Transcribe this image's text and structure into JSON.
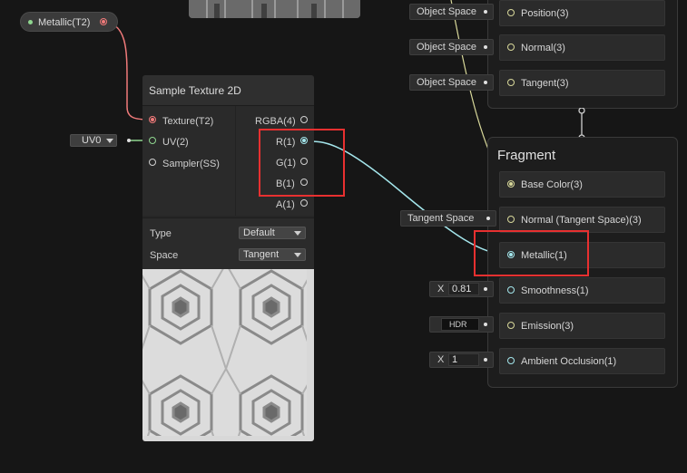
{
  "property_node": {
    "label": "Metallic(T2)"
  },
  "sample_texture": {
    "title": "Sample Texture 2D",
    "inputs": [
      "Texture(T2)",
      "UV(2)",
      "Sampler(SS)"
    ],
    "outputs": [
      "RGBA(4)",
      "R(1)",
      "G(1)",
      "B(1)",
      "A(1)"
    ],
    "type_label": "Type",
    "type_value": "Default",
    "space_label": "Space",
    "space_value": "Tangent"
  },
  "uv_field": {
    "value": "UV0"
  },
  "vertex_stack": {
    "blocks": [
      {
        "label": "Position(3)",
        "space": "Object Space"
      },
      {
        "label": "Normal(3)",
        "space": "Object Space"
      },
      {
        "label": "Tangent(3)",
        "space": "Object Space"
      }
    ]
  },
  "fragment_stack": {
    "title": "Fragment",
    "blocks": [
      {
        "label": "Base Color(3)"
      },
      {
        "label": "Normal (Tangent Space)(3)",
        "space": "Tangent Space"
      },
      {
        "label": "Metallic(1)"
      },
      {
        "label": "Smoothness(1)",
        "prefix": "X",
        "value": "0.81"
      },
      {
        "label": "Emission(3)",
        "value": "HDR"
      },
      {
        "label": "Ambient Occlusion(1)",
        "prefix": "X",
        "value": "1"
      }
    ]
  },
  "colors": {
    "background": "#161616",
    "texture_wire": "#f07a7a",
    "vector_wire": "#d8d89a",
    "float_wire": "#a4e6ec",
    "uv_wire": "#8fd68f",
    "highlight": "#e83030"
  }
}
